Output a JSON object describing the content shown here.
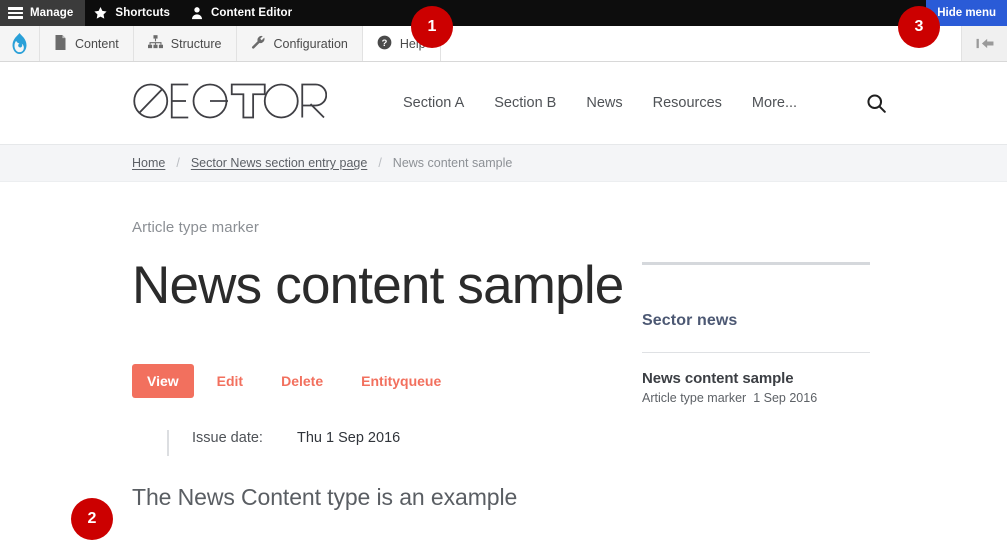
{
  "admin_bar": {
    "items": [
      {
        "label": "Manage",
        "icon": "hamburger-icon",
        "active": true
      },
      {
        "label": "Shortcuts",
        "icon": "star-icon",
        "active": false
      },
      {
        "label": "Content Editor",
        "icon": "person-icon",
        "active": false
      }
    ],
    "hide_menu_label": "Hide menu",
    "hide_menu_color": "#2a5bd7"
  },
  "admin_tray": {
    "logo_icon": "drupal-drop-icon",
    "items": [
      {
        "label": "Content",
        "icon": "document-icon"
      },
      {
        "label": "Structure",
        "icon": "sitemap-icon"
      },
      {
        "label": "Configuration",
        "icon": "wrench-icon"
      },
      {
        "label": "Help",
        "icon": "question-circle-icon"
      }
    ],
    "orientation_icon": "collapse-left-icon"
  },
  "site_header": {
    "logo_text": "SECTOR",
    "nav": [
      {
        "label": "Section A"
      },
      {
        "label": "Section B"
      },
      {
        "label": "News"
      },
      {
        "label": "Resources"
      },
      {
        "label": "More..."
      }
    ],
    "search_icon": "search-icon"
  },
  "breadcrumb": {
    "items": [
      {
        "label": "Home",
        "link": true
      },
      {
        "label": "Sector News section entry page",
        "link": true
      },
      {
        "label": "News content sample",
        "link": false
      }
    ],
    "separator": "/"
  },
  "article": {
    "kicker": "Article type marker",
    "title": "News content sample",
    "body_excerpt": "The News Content type is an example",
    "fields": [
      {
        "label": "Issue date:",
        "value": "Thu 1 Sep 2016"
      }
    ]
  },
  "local_tasks": {
    "active_color": "#f2705e",
    "items": [
      {
        "label": "View",
        "active": true
      },
      {
        "label": "Edit",
        "active": false
      },
      {
        "label": "Delete",
        "active": false
      },
      {
        "label": "Entityqueue",
        "active": false
      }
    ]
  },
  "sidebar": {
    "heading": "Sector news",
    "items": [
      {
        "title": "News content sample",
        "type": "Article type marker",
        "date": "1 Sep 2016"
      }
    ]
  },
  "annotations": {
    "badge_color": "#cc0000",
    "markers": [
      {
        "number": "1"
      },
      {
        "number": "2"
      },
      {
        "number": "3"
      }
    ]
  }
}
